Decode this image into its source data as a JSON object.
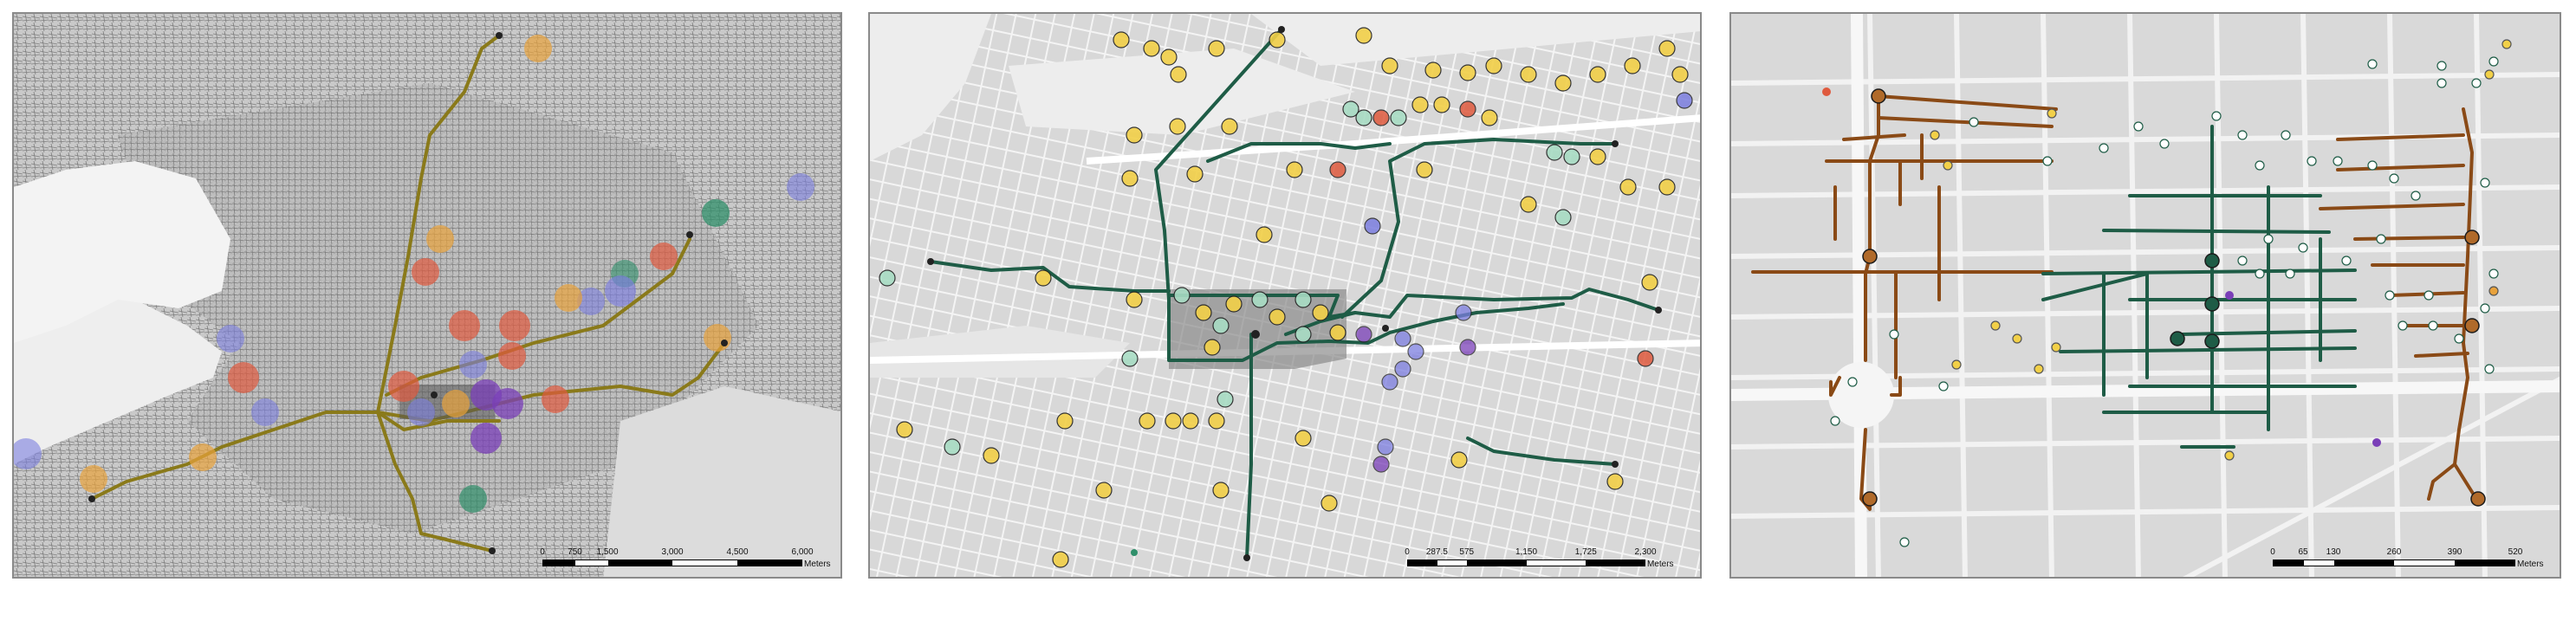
{
  "colors": {
    "orange": "#e8a23c",
    "red": "#df5a3e",
    "blue": "#7c7ee0",
    "green": "#2f8f6a",
    "purple": "#7a3fb8",
    "line_olive": "#8a7a1a",
    "line_green": "#1e5c46",
    "line_brown": "#8a4a16",
    "yellow": "#f2d048",
    "mint": "#a8dcc4"
  },
  "panels": [
    {
      "id": "left-map",
      "scale": {
        "ticks": [
          "0",
          "750",
          "1,500",
          "3,000",
          "4,500",
          "6,000"
        ],
        "unit": "Meters"
      }
    },
    {
      "id": "middle-map",
      "scale": {
        "ticks": [
          "0",
          "287.5",
          "575",
          "1,150",
          "1,725",
          "2,300"
        ],
        "unit": "Meters"
      }
    },
    {
      "id": "right-map",
      "scale": {
        "ticks": [
          "0",
          "65",
          "130",
          "260",
          "390",
          "520"
        ],
        "unit": "Meters"
      }
    }
  ]
}
